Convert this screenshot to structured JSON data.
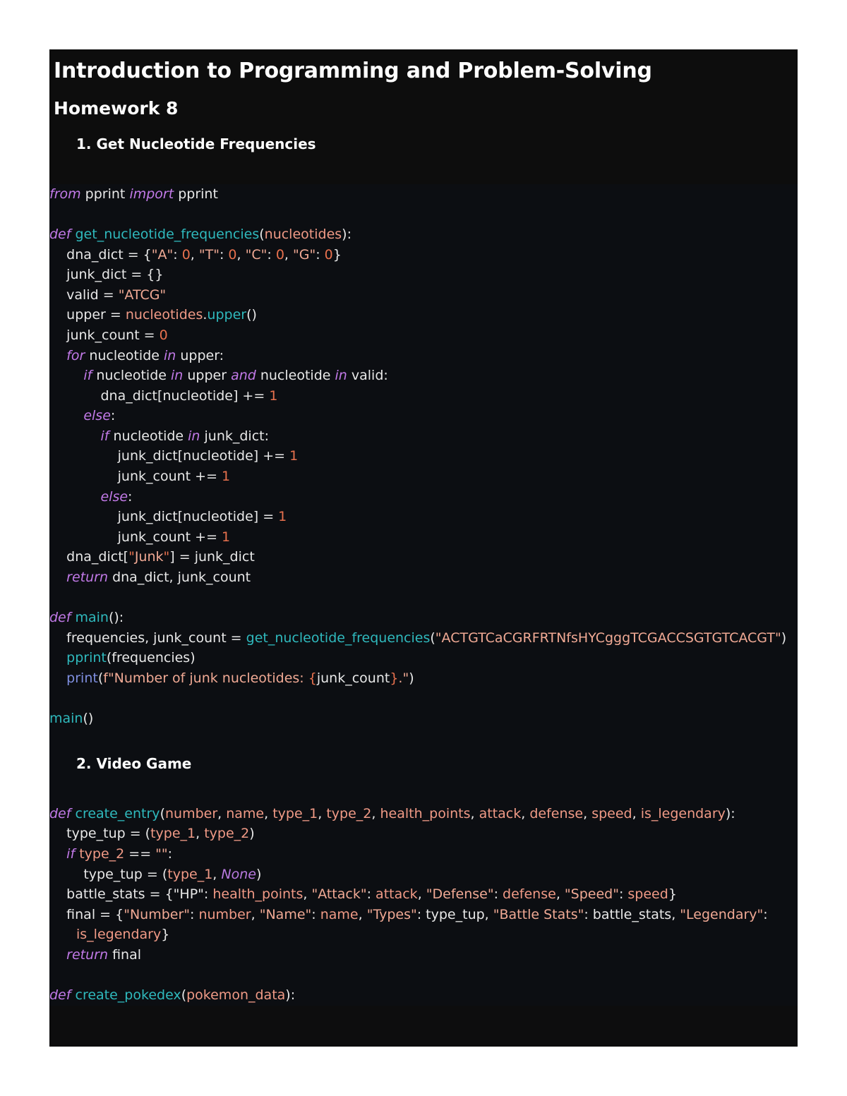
{
  "document": {
    "title": "Introduction to Programming and Problem-Solving",
    "subtitle": "Homework 8"
  },
  "sections": [
    {
      "heading": "1. Get Nucleotide Frequencies",
      "code_lines": [
        "from pprint import pprint",
        "",
        "def get_nucleotide_frequencies(nucleotides):",
        "    dna_dict = {\"A\": 0, \"T\": 0, \"C\": 0, \"G\": 0}",
        "    junk_dict = {}",
        "    valid = \"ATCG\"",
        "    upper = nucleotides.upper()",
        "    junk_count = 0",
        "    for nucleotide in upper:",
        "        if nucleotide in upper and nucleotide in valid:",
        "            dna_dict[nucleotide] += 1",
        "        else:",
        "            if nucleotide in junk_dict:",
        "                junk_dict[nucleotide] += 1",
        "                junk_count += 1",
        "            else:",
        "                junk_dict[nucleotide] = 1",
        "                junk_count += 1",
        "    dna_dict[\"Junk\"] = junk_dict",
        "    return dna_dict, junk_count",
        "",
        "def main():",
        "    frequencies, junk_count = get_nucleotide_frequencies(\"ACTGTCaCGRFRTNfsHYCgggTCGACCSGTGTCACGT\")",
        "    pprint(frequencies)",
        "    print(f\"Number of junk nucleotides: {junk_count}.\")",
        "",
        "main()"
      ],
      "dna_sequence": "ACTGTCaCGRFRTNfsHYCgggTCGACCSGTGTCACGT"
    },
    {
      "heading": "2. Video Game",
      "code_lines": [
        "def create_entry(number, name, type_1, type_2, health_points, attack, defense, speed, is_legendary):",
        "    type_tup = (type_1, type_2)",
        "    if type_2 == \"\":",
        "        type_tup = (type_1, None)",
        "    battle_stats = {\"HP\": health_points, \"Attack\": attack, \"Defense\": defense, \"Speed\": speed}",
        "    final = {\"Number\": number, \"Name\": name, \"Types\": type_tup, \"Battle Stats\": battle_stats, \"Legendary\": is_legendary}",
        "    return final",
        "",
        "def create_pokedex(pokemon_data):"
      ]
    }
  ],
  "code_tokens": {
    "s1": [
      [
        [
          "kw",
          "from"
        ],
        [
          "pl",
          " pprint "
        ],
        [
          "kw",
          "import"
        ],
        [
          "pl",
          " pprint"
        ]
      ],
      [],
      [
        [
          "kw",
          "def"
        ],
        [
          "pl",
          " "
        ],
        [
          "fn",
          "get_nucleotide_frequencies"
        ],
        [
          "pl",
          "("
        ],
        [
          "var",
          "nucleotides"
        ],
        [
          "pl",
          "):"
        ]
      ],
      [
        [
          "pl",
          "    dna_dict = {"
        ],
        [
          "str",
          "\"A\""
        ],
        [
          "pl",
          ": "
        ],
        [
          "num",
          "0"
        ],
        [
          "pl",
          ", "
        ],
        [
          "str",
          "\"T\""
        ],
        [
          "pl",
          ": "
        ],
        [
          "num",
          "0"
        ],
        [
          "pl",
          ", "
        ],
        [
          "str",
          "\"C\""
        ],
        [
          "pl",
          ": "
        ],
        [
          "num",
          "0"
        ],
        [
          "pl",
          ", "
        ],
        [
          "str",
          "\"G\""
        ],
        [
          "pl",
          ": "
        ],
        [
          "num",
          "0"
        ],
        [
          "pl",
          "}"
        ]
      ],
      [
        [
          "pl",
          "    junk_dict = {}"
        ]
      ],
      [
        [
          "pl",
          "    valid = "
        ],
        [
          "str",
          "\"ATCG\""
        ]
      ],
      [
        [
          "pl",
          "    upper = "
        ],
        [
          "var",
          "nucleotides"
        ],
        [
          "pl",
          "."
        ],
        [
          "fn",
          "upper"
        ],
        [
          "pl",
          "()"
        ]
      ],
      [
        [
          "pl",
          "    junk_count = "
        ],
        [
          "num",
          "0"
        ]
      ],
      [
        [
          "pl",
          "    "
        ],
        [
          "kw",
          "for"
        ],
        [
          "pl",
          " nucleotide "
        ],
        [
          "kw",
          "in"
        ],
        [
          "pl",
          " upper:"
        ]
      ],
      [
        [
          "pl",
          "        "
        ],
        [
          "kw",
          "if"
        ],
        [
          "pl",
          " nucleotide "
        ],
        [
          "kw",
          "in"
        ],
        [
          "pl",
          " upper "
        ],
        [
          "kw",
          "and"
        ],
        [
          "pl",
          " nucleotide "
        ],
        [
          "kw",
          "in"
        ],
        [
          "pl",
          " valid:"
        ]
      ],
      [
        [
          "pl",
          "            dna_dict[nucleotide] += "
        ],
        [
          "num",
          "1"
        ]
      ],
      [
        [
          "pl",
          "        "
        ],
        [
          "kw",
          "else"
        ],
        [
          "pl",
          ":"
        ]
      ],
      [
        [
          "pl",
          "            "
        ],
        [
          "kw",
          "if"
        ],
        [
          "pl",
          " nucleotide "
        ],
        [
          "kw",
          "in"
        ],
        [
          "pl",
          " junk_dict:"
        ]
      ],
      [
        [
          "pl",
          "                junk_dict[nucleotide] += "
        ],
        [
          "num",
          "1"
        ]
      ],
      [
        [
          "pl",
          "                junk_count += "
        ],
        [
          "num",
          "1"
        ]
      ],
      [
        [
          "pl",
          "            "
        ],
        [
          "kw",
          "else"
        ],
        [
          "pl",
          ":"
        ]
      ],
      [
        [
          "pl",
          "                junk_dict[nucleotide] = "
        ],
        [
          "num",
          "1"
        ]
      ],
      [
        [
          "pl",
          "                junk_count += "
        ],
        [
          "num",
          "1"
        ]
      ],
      [
        [
          "pl",
          "    dna_dict["
        ],
        [
          "num",
          "\""
        ],
        [
          "str",
          "Junk"
        ],
        [
          "num",
          "\""
        ],
        [
          "pl",
          "] = junk_dict"
        ]
      ],
      [
        [
          "pl",
          "    "
        ],
        [
          "kw",
          "return"
        ],
        [
          "pl",
          " dna_dict, junk_count"
        ]
      ],
      [],
      [
        [
          "kw",
          "def"
        ],
        [
          "pl",
          " "
        ],
        [
          "fn",
          "main"
        ],
        [
          "pl",
          "():"
        ]
      ],
      [
        [
          "pl",
          "    frequencies, junk_count = "
        ],
        [
          "fn",
          "get_nucleotide_frequencies"
        ],
        [
          "pl",
          "("
        ],
        [
          "str",
          "\"ACTGTCaCGRFRTNfsHYCgggTCGACCSGTGTCACGT\""
        ],
        [
          "pl",
          ")"
        ]
      ],
      [
        [
          "pl",
          "    "
        ],
        [
          "fn",
          "pprint"
        ],
        [
          "pl",
          "(frequencies)"
        ]
      ],
      [
        [
          "pl",
          "    "
        ],
        [
          "bi",
          "print"
        ],
        [
          "pl",
          "("
        ],
        [
          "str",
          "f\"Number of junk nucleotides: "
        ],
        [
          "num",
          "{"
        ],
        [
          "pl",
          "junk_count"
        ],
        [
          "num",
          "}"
        ],
        [
          "str",
          ".\""
        ],
        [
          "pl",
          ")"
        ]
      ],
      [],
      [
        [
          "fn",
          "main"
        ],
        [
          "pl",
          "()"
        ]
      ]
    ],
    "s2": [
      [
        [
          "kw",
          "def"
        ],
        [
          "pl",
          " "
        ],
        [
          "fn",
          "create_entry"
        ],
        [
          "pl",
          "("
        ],
        [
          "var",
          "number"
        ],
        [
          "pl",
          ", "
        ],
        [
          "var",
          "name"
        ],
        [
          "pl",
          ", "
        ],
        [
          "var",
          "type_1"
        ],
        [
          "pl",
          ", "
        ],
        [
          "var",
          "type_2"
        ],
        [
          "pl",
          ", "
        ],
        [
          "var",
          "health_points"
        ],
        [
          "pl",
          ", "
        ],
        [
          "var",
          "attack"
        ],
        [
          "pl",
          ", "
        ],
        [
          "var",
          "defense"
        ],
        [
          "pl",
          ", "
        ],
        [
          "var",
          "speed"
        ],
        [
          "pl",
          ", "
        ],
        [
          "var",
          "is_legendary"
        ],
        [
          "pl",
          "):"
        ]
      ],
      [
        [
          "pl",
          "    type_tup = ("
        ],
        [
          "var",
          "type_1"
        ],
        [
          "pl",
          ", "
        ],
        [
          "var",
          "type_2"
        ],
        [
          "pl",
          ")"
        ]
      ],
      [
        [
          "pl",
          "    "
        ],
        [
          "kw",
          "if"
        ],
        [
          "pl",
          " "
        ],
        [
          "var",
          "type_2"
        ],
        [
          "pl",
          " == "
        ],
        [
          "str",
          "\"\""
        ],
        [
          "pl",
          ":"
        ]
      ],
      [
        [
          "pl",
          "        type_tup = ("
        ],
        [
          "var",
          "type_1"
        ],
        [
          "pl",
          ", "
        ],
        [
          "none",
          "None"
        ],
        [
          "pl",
          ")"
        ]
      ],
      [
        [
          "pl",
          "    battle_stats = {"
        ],
        [
          "pl",
          "\"HP\""
        ],
        [
          "pl",
          ": "
        ],
        [
          "var",
          "health_points"
        ],
        [
          "pl",
          ", "
        ],
        [
          "str",
          "\"Attack\""
        ],
        [
          "pl",
          ": "
        ],
        [
          "var",
          "attack"
        ],
        [
          "pl",
          ", "
        ],
        [
          "str",
          "\"Defense\""
        ],
        [
          "pl",
          ": "
        ],
        [
          "var",
          "defense"
        ],
        [
          "pl",
          ", "
        ],
        [
          "str",
          "\"Speed\""
        ],
        [
          "pl",
          ": "
        ],
        [
          "var",
          "speed"
        ],
        [
          "pl",
          "}"
        ]
      ],
      [
        [
          "pl",
          "    final = {"
        ],
        [
          "str",
          "\"Number\""
        ],
        [
          "pl",
          ": "
        ],
        [
          "var",
          "number"
        ],
        [
          "pl",
          ", "
        ],
        [
          "str",
          "\"Name\""
        ],
        [
          "pl",
          ": "
        ],
        [
          "var",
          "name"
        ],
        [
          "pl",
          ", "
        ],
        [
          "str",
          "\"Types\""
        ],
        [
          "pl",
          ": type_tup, "
        ],
        [
          "str",
          "\"Battle Stats\""
        ],
        [
          "pl",
          ": battle_stats, "
        ],
        [
          "str",
          "\"Legendary\""
        ],
        [
          "pl",
          ": "
        ],
        [
          "var",
          "is_legendary"
        ],
        [
          "pl",
          "}"
        ]
      ],
      [
        [
          "pl",
          "    "
        ],
        [
          "kw",
          "return"
        ],
        [
          "pl",
          " final"
        ]
      ],
      [],
      [
        [
          "kw",
          "def"
        ],
        [
          "pl",
          " "
        ],
        [
          "fn",
          "create_pokedex"
        ],
        [
          "pl",
          "("
        ],
        [
          "var",
          "pokemon_data"
        ],
        [
          "pl",
          "):"
        ]
      ]
    ]
  },
  "colors": {
    "page_background": "#ffffff",
    "block_background": "#0d0d0e",
    "code_background": "#0c0e12",
    "text": "#e8e8e8",
    "keyword": "#c27ae8",
    "function": "#2fb9bd",
    "builtin": "#7f8fe0",
    "variable": "#f09a86",
    "string": "#f0a994",
    "number": "#e8714e"
  }
}
